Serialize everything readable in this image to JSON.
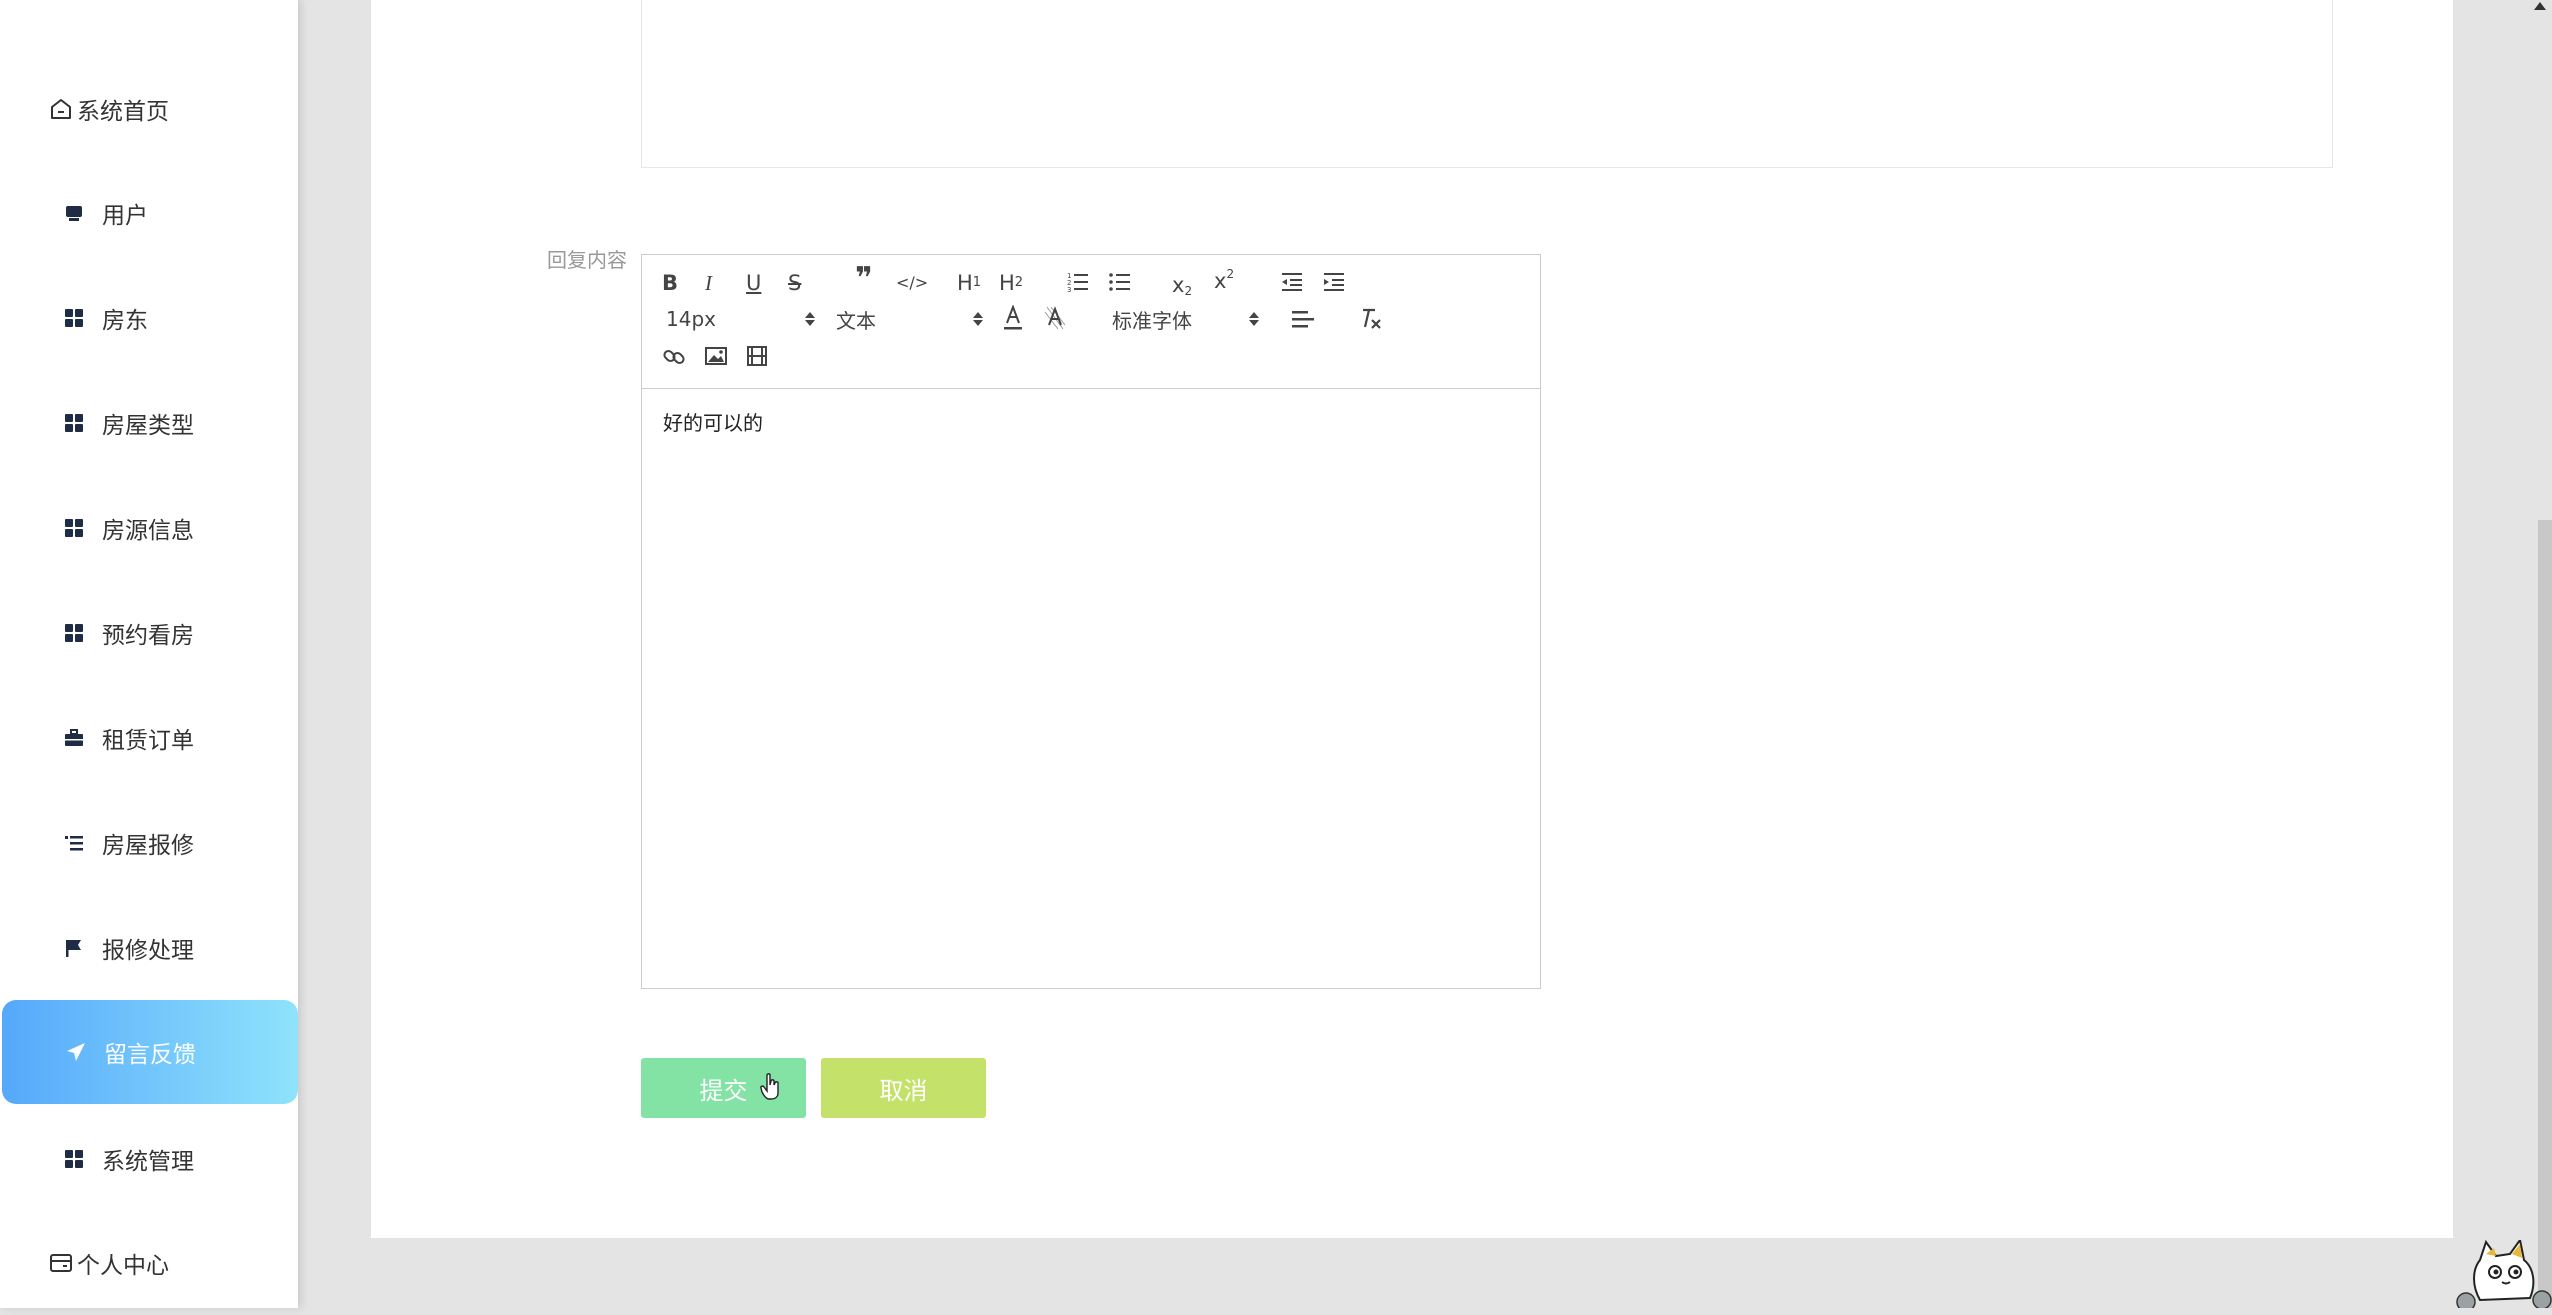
{
  "sidebar": {
    "items": [
      {
        "label": "系统首页",
        "icon": "home-icon"
      },
      {
        "label": "用户",
        "icon": "monitor-icon"
      },
      {
        "label": "房东",
        "icon": "grid-icon"
      },
      {
        "label": "房屋类型",
        "icon": "grid-icon"
      },
      {
        "label": "房源信息",
        "icon": "grid-icon"
      },
      {
        "label": "预约看房",
        "icon": "grid-icon"
      },
      {
        "label": "租赁订单",
        "icon": "briefcase-icon"
      },
      {
        "label": "房屋报修",
        "icon": "list-icon"
      },
      {
        "label": "报修处理",
        "icon": "flag-icon"
      },
      {
        "label": "留言反馈",
        "icon": "send-icon",
        "active": true
      },
      {
        "label": "系统管理",
        "icon": "grid-icon"
      },
      {
        "label": "个人中心",
        "icon": "card-icon"
      }
    ],
    "active_gradient": [
      "#55a8fb",
      "#8fe3fb"
    ]
  },
  "form": {
    "reply_label": "回复内容",
    "editor": {
      "font_size": "14px",
      "header_picker": "文本",
      "font_family": "标准字体",
      "content": "好的可以的"
    },
    "submit_label": "提交",
    "cancel_label": "取消",
    "submit_color": "#83e3a5",
    "cancel_color": "#c4e16a"
  }
}
